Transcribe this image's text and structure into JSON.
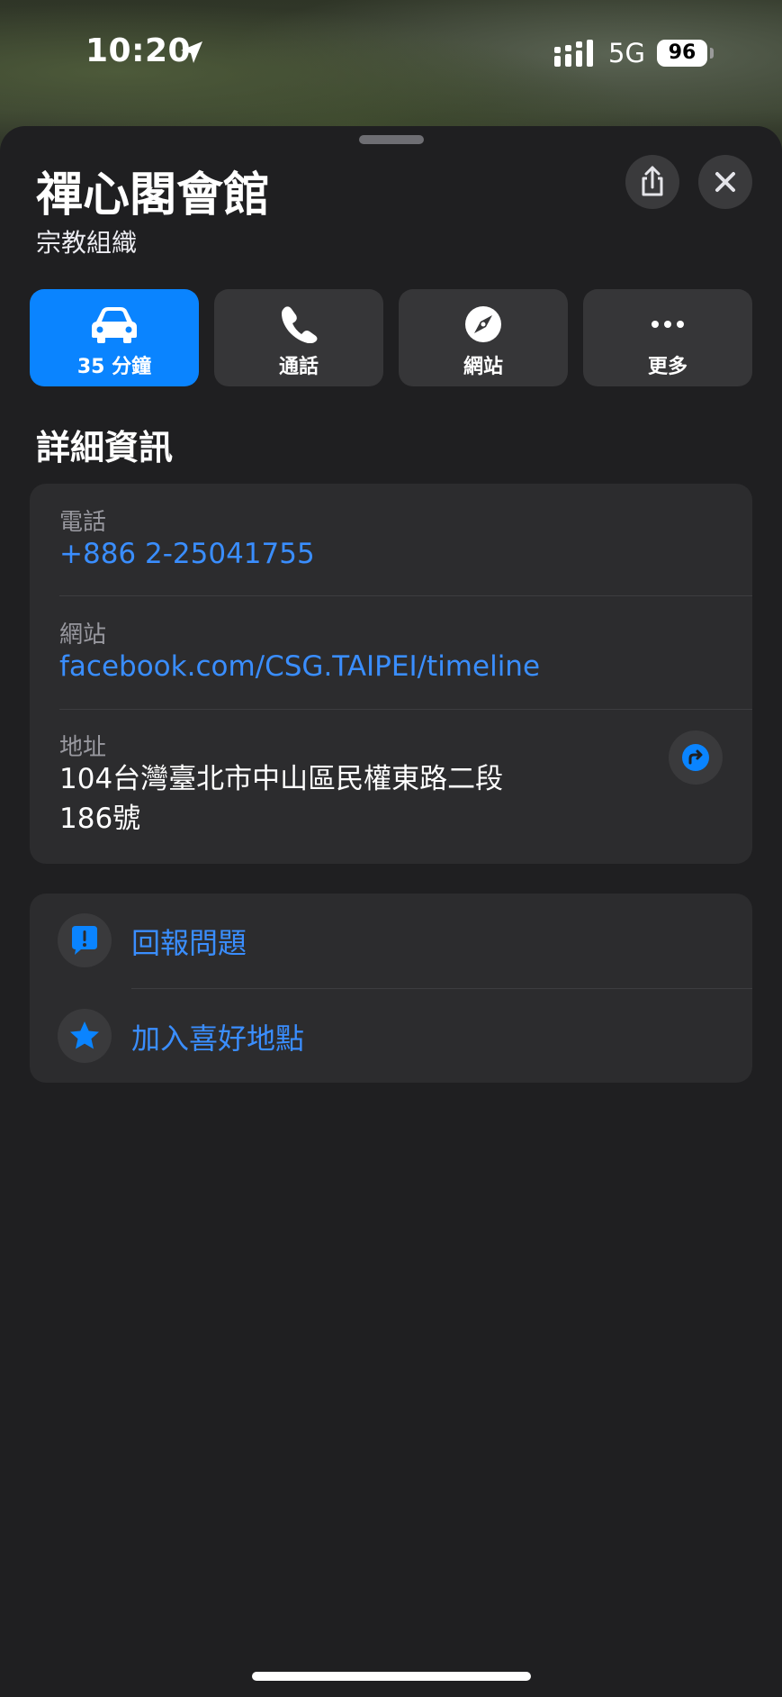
{
  "status_bar": {
    "time": "10:20",
    "network": "5G",
    "battery": "96"
  },
  "place": {
    "title": "禪心閣會館",
    "category": "宗教組織"
  },
  "actions": [
    {
      "label": "35 分鐘",
      "icon": "car-icon"
    },
    {
      "label": "通話",
      "icon": "phone-icon"
    },
    {
      "label": "網站",
      "icon": "compass-icon"
    },
    {
      "label": "更多",
      "icon": "ellipsis-icon"
    }
  ],
  "details": {
    "heading": "詳細資訊",
    "phone_label": "電話",
    "phone_value": "+886 2-25041755",
    "website_label": "網站",
    "website_value": "facebook.com/CSG.TAIPEI/timeline",
    "address_label": "地址",
    "address_line1": "104台灣臺北市中山區民權東路二段",
    "address_line2": "186號"
  },
  "more": {
    "report": "回報問題",
    "favorite": "加入喜好地點"
  },
  "colors": {
    "accent": "#0a84ff",
    "link": "#3a8eff",
    "sheet": "#1f1f21",
    "card": "#2c2c2e"
  }
}
